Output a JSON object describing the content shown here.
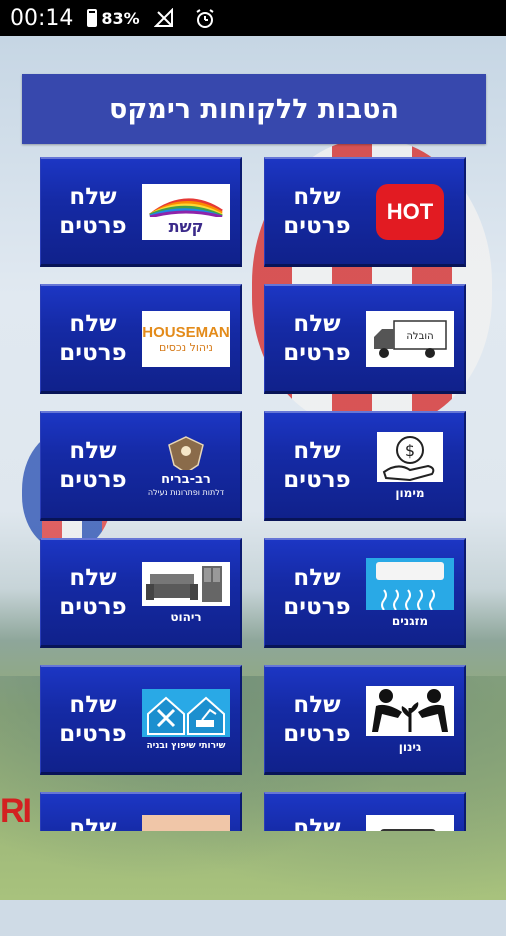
{
  "status_bar": {
    "time": "00:14",
    "battery": "83%"
  },
  "header": {
    "title": "הטבות ללקוחות רימקס"
  },
  "tiles": [
    {
      "label": "שלח פרטים",
      "logo_text": "HOT",
      "icon": "hot-logo"
    },
    {
      "label": "שלח פרטים",
      "logo_text": "קשת",
      "icon": "keshet-logo"
    },
    {
      "label": "שלח פרטים",
      "logo_text": "הובלה",
      "icon": "moving-truck-icon"
    },
    {
      "label": "שלח פרטים",
      "logo_text": "HOUSEMAN",
      "logo_sub": "ניהול נכסים",
      "icon": "houseman-logo"
    },
    {
      "label": "שלח פרטים",
      "caption": "מימון",
      "icon": "money-hand-icon"
    },
    {
      "label": "שלח פרטים",
      "logo_text": "רב-בריח",
      "logo_sub": "דלתות ופתרונות נעילה",
      "icon": "rav-bariach-logo"
    },
    {
      "label": "שלח פרטים",
      "caption": "מזגנים",
      "icon": "air-conditioner-icon"
    },
    {
      "label": "שלח פרטים",
      "caption": "ריהוט",
      "icon": "furniture-icon"
    },
    {
      "label": "שלח פרטים",
      "caption": "גינון",
      "icon": "gardening-icon"
    },
    {
      "label": "שלח פרטים",
      "caption": "שירותי שיפוץ ובניה",
      "icon": "renovation-icon"
    },
    {
      "label": "שלח",
      "icon": "security-camera-icon"
    },
    {
      "label": "שלח",
      "icon": "hand-icon"
    }
  ],
  "background": {
    "brand_fragment": "RI"
  },
  "colors": {
    "header_bg": "#3748ad",
    "tile_bg": "#1a30b8",
    "hot_red": "#e21b22"
  }
}
